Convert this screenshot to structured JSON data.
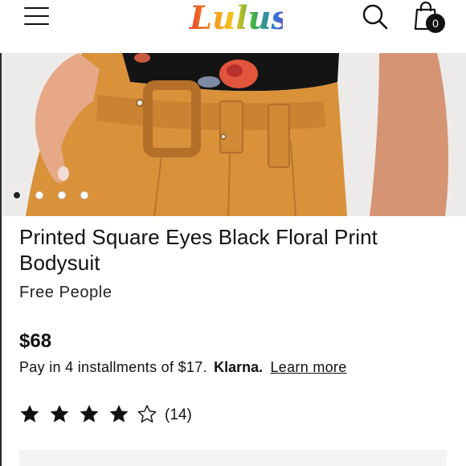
{
  "header": {
    "menu_icon": "hamburger-menu-icon",
    "logo_text": "Lulus",
    "search_icon": "search-icon",
    "bag_icon": "shopping-bag-icon",
    "bag_count": "0"
  },
  "carousel": {
    "slides": 4,
    "active_index": 0
  },
  "product": {
    "title": "Printed Square Eyes Black Floral Print Bodysuit",
    "brand": "Free People",
    "price": "$68",
    "installments_text": "Pay in 4 installments of $17.",
    "klarna_label": "Klarna.",
    "learn_more": "Learn more",
    "rating": 4,
    "rating_max": 5,
    "review_count": "(14)"
  },
  "colors": {
    "skirt": "#d9913a",
    "text": "#111111",
    "logo_gradient": [
      "#e8432f",
      "#f29a1f",
      "#f5c518",
      "#3bb04a",
      "#2a7bd8",
      "#8a3fc0"
    ]
  }
}
